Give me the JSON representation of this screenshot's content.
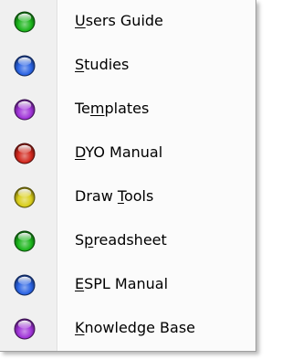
{
  "colors": {
    "green": "#1bb51b",
    "blue": "#2a63e3",
    "purple": "#a033d8",
    "red": "#d2281e",
    "yellow": "#d9cd1a"
  },
  "menu": {
    "items": [
      {
        "id": "users-guide",
        "pre": "",
        "acc": "U",
        "post": "sers Guide",
        "icon": "green-orb-icon",
        "color": "green"
      },
      {
        "id": "studies",
        "pre": "",
        "acc": "S",
        "post": "tudies",
        "icon": "blue-orb-icon",
        "color": "blue"
      },
      {
        "id": "templates",
        "pre": "Te",
        "acc": "m",
        "post": "plates",
        "icon": "purple-orb-icon",
        "color": "purple"
      },
      {
        "id": "dyo-manual",
        "pre": "",
        "acc": "D",
        "post": "YO Manual",
        "icon": "red-orb-icon",
        "color": "red"
      },
      {
        "id": "draw-tools",
        "pre": "Draw ",
        "acc": "T",
        "post": "ools",
        "icon": "yellow-orb-icon",
        "color": "yellow"
      },
      {
        "id": "spreadsheet",
        "pre": "S",
        "acc": "p",
        "post": "readsheet",
        "icon": "green-orb-icon",
        "color": "green"
      },
      {
        "id": "espl-manual",
        "pre": "",
        "acc": "E",
        "post": "SPL Manual",
        "icon": "blue-orb-icon",
        "color": "blue"
      },
      {
        "id": "knowledge-base",
        "pre": "",
        "acc": "K",
        "post": "nowledge Base",
        "icon": "purple-orb-icon",
        "color": "purple"
      }
    ]
  }
}
